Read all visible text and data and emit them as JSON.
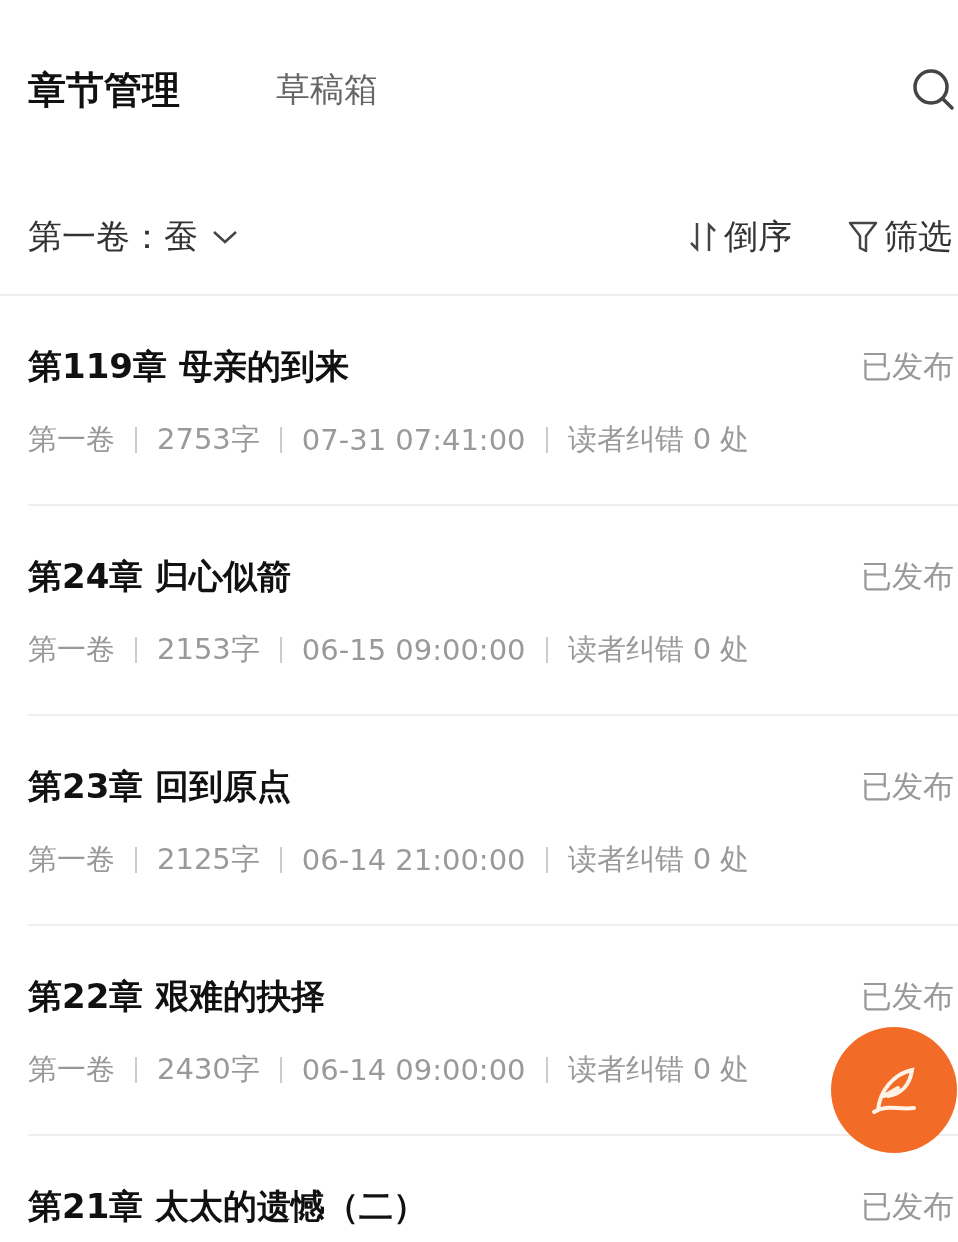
{
  "tabs": [
    {
      "label": "章节管理",
      "selected": true
    },
    {
      "label": "草稿箱",
      "selected": false
    }
  ],
  "toolbar": {
    "volume": "第一卷：蚕",
    "sort": "倒序",
    "filter": "筛选"
  },
  "chapters": [
    {
      "title": "第119章 母亲的到来",
      "status": "已发布",
      "meta": [
        "第一卷",
        "2753字",
        "07-31 07:41:00",
        "读者纠错 0 处"
      ]
    },
    {
      "title": "第24章 归心似箭",
      "status": "已发布",
      "meta": [
        "第一卷",
        "2153字",
        "06-15 09:00:00",
        "读者纠错 0 处"
      ]
    },
    {
      "title": "第23章 回到原点",
      "status": "已发布",
      "meta": [
        "第一卷",
        "2125字",
        "06-14 21:00:00",
        "读者纠错 0 处"
      ]
    },
    {
      "title": "第22章 艰难的抉择",
      "status": "已发布",
      "meta": [
        "第一卷",
        "2430字",
        "06-14 09:00:00",
        "读者纠错 0 处"
      ]
    },
    {
      "title": "第21章 太太的遗憾（二）",
      "status": "已发布"
    }
  ]
}
